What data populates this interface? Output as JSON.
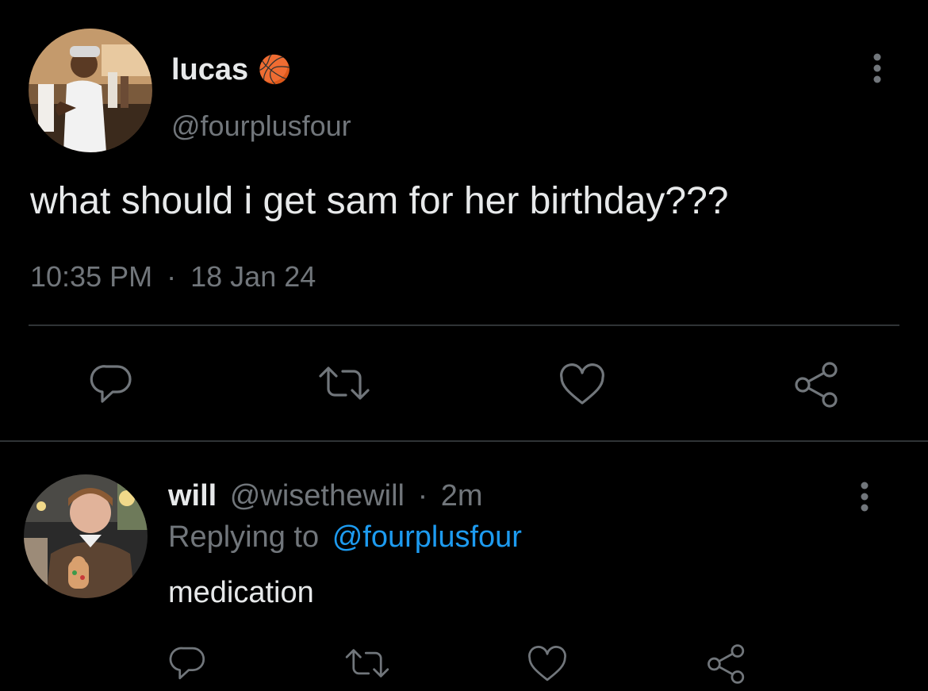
{
  "main_tweet": {
    "author_name": "lucas",
    "name_emoji": "🏀",
    "handle": "@fourplusfour",
    "text": "what should i get sam for her birthday???",
    "time": "10:35 PM",
    "separator": "·",
    "date": "18 Jan 24",
    "avatar_icon": "profile-photo",
    "actions": [
      "reply-icon",
      "retweet-icon",
      "like-icon",
      "share-icon"
    ]
  },
  "reply": {
    "author_name": "will",
    "handle": "@wisethewill",
    "separator": "·",
    "age": "2m",
    "replying_prefix": "Replying to",
    "replying_handle": "@fourplusfour",
    "text": "medication",
    "avatar_icon": "profile-photo",
    "actions": [
      "reply-icon",
      "retweet-icon",
      "like-icon",
      "share-icon"
    ]
  },
  "colors": {
    "background": "#000000",
    "text": "#e7e9ea",
    "muted": "#71767b",
    "link": "#1d9bf0",
    "divider": "#2f3336"
  }
}
